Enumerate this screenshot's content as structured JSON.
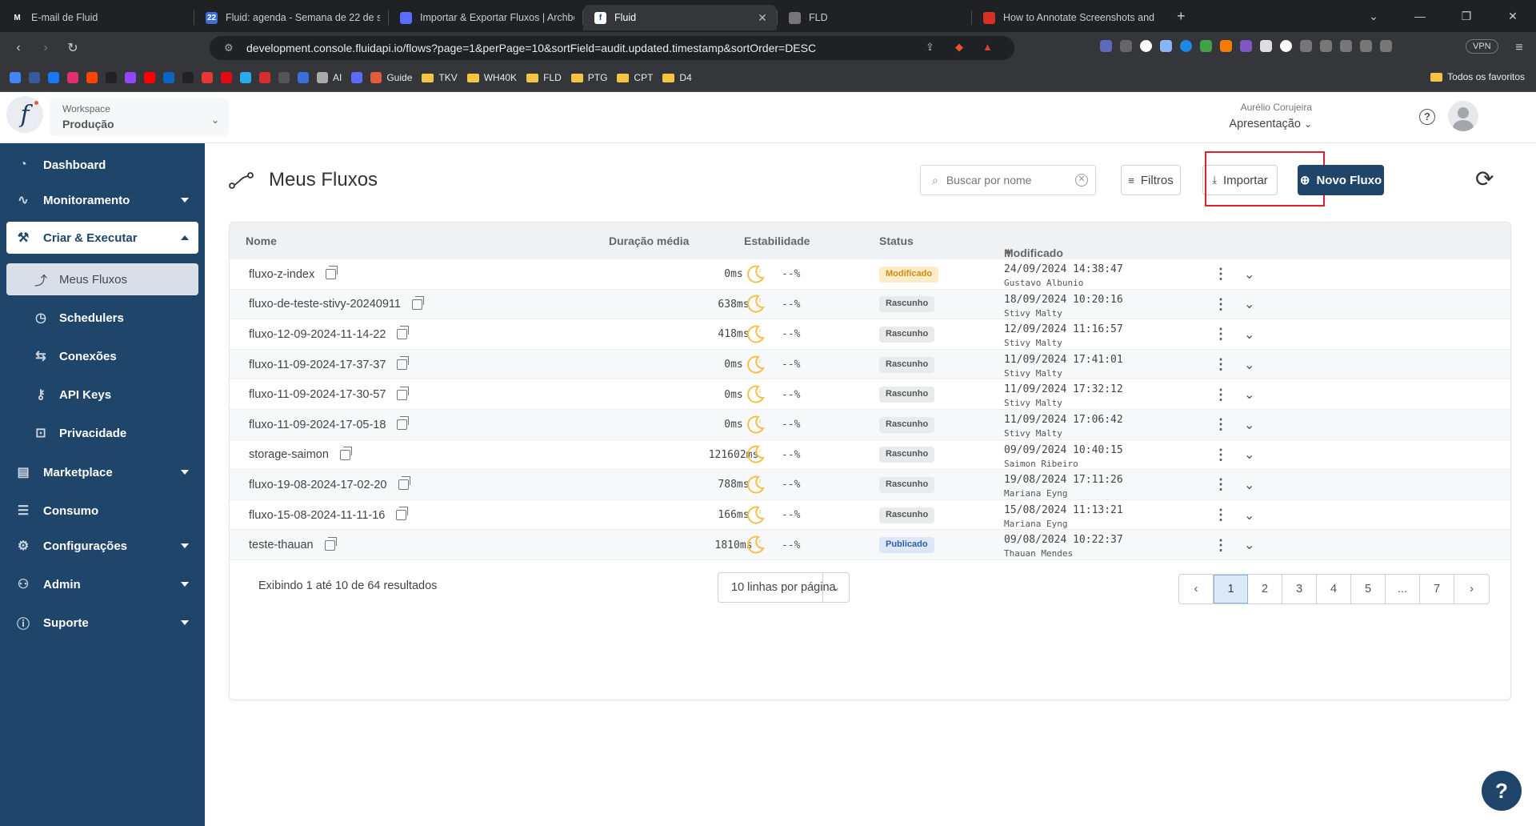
{
  "browser": {
    "tabs": [
      {
        "title": "E-mail de Fluid",
        "fav_color": "#202124",
        "fav_text": "M",
        "active": false
      },
      {
        "title": "Fluid: agenda - Semana de 22 de se",
        "fav_color": "#3b6fd8",
        "fav_text": "22",
        "active": false
      },
      {
        "title": "Importar & Exportar Fluxos | Archbe",
        "fav_color": "#5b6cff",
        "fav_text": "",
        "active": false
      },
      {
        "title": "Fluid",
        "fav_color": "#ffffff",
        "fav_text": "f",
        "active": true
      },
      {
        "title": "FLD",
        "fav_color": "#777",
        "fav_text": "",
        "active": false
      },
      {
        "title": "How to Annotate Screenshots and I",
        "fav_color": "#d93025",
        "fav_text": "",
        "active": false
      }
    ],
    "url": "development.console.fluidapi.io/flows?page=1&perPage=10&sortField=audit.updated.timestamp&sortOrder=DESC",
    "vpn_label": "VPN",
    "bookmarks": [
      {
        "label": "",
        "color": "#4285f4"
      },
      {
        "label": "",
        "color": "#3b5998"
      },
      {
        "label": "",
        "color": "#1877f2"
      },
      {
        "label": "",
        "color": "#e1306c"
      },
      {
        "label": "",
        "color": "#ff4500"
      },
      {
        "label": "",
        "color": "#222"
      },
      {
        "label": "",
        "color": "#9146ff"
      },
      {
        "label": "",
        "color": "#ff0000"
      },
      {
        "label": "",
        "color": "#0a66c2"
      },
      {
        "label": "",
        "color": "#222"
      },
      {
        "label": "",
        "color": "#e53935"
      },
      {
        "label": "",
        "color": "#e50914"
      },
      {
        "label": "",
        "color": "#2aabee"
      },
      {
        "label": "",
        "color": "#d32f2f"
      },
      {
        "label": "",
        "color": "#555"
      },
      {
        "label": "",
        "color": "#3b6fd8"
      },
      {
        "label": "AI",
        "color": "#aaa"
      },
      {
        "label": "",
        "color": "#5b6cff"
      },
      {
        "label": "Guide",
        "color": "#e25c3a"
      }
    ],
    "bookmark_folders": [
      "TKV",
      "WH40K",
      "FLD",
      "PTG",
      "CPT",
      "D4"
    ],
    "all_bookmarks": "Todos os favoritos"
  },
  "header": {
    "workspace_label": "Workspace",
    "workspace_value": "Produção",
    "user_name": "Aurélio Corujeira",
    "user_workspace": "Apresentação"
  },
  "sidebar": {
    "dashboard": "Dashboard",
    "monitoramento": "Monitoramento",
    "criar": "Criar & Executar",
    "meus_fluxos": "Meus Fluxos",
    "schedulers": "Schedulers",
    "conexoes": "Conexões",
    "api_keys": "API Keys",
    "privacidade": "Privacidade",
    "marketplace": "Marketplace",
    "consumo": "Consumo",
    "configuracoes": "Configurações",
    "admin": "Admin",
    "suporte": "Suporte"
  },
  "page": {
    "title": "Meus Fluxos",
    "search_placeholder": "Buscar por nome",
    "filters_label": "Filtros",
    "import_label": "Importar",
    "new_flow_label": "Novo Fluxo"
  },
  "table": {
    "headers": {
      "name": "Nome",
      "duration": "Duração média",
      "stability": "Estabilidade",
      "status": "Status",
      "modified": "Modificado"
    },
    "rows": [
      {
        "name": "fluxo-z-index",
        "duration": "0ms",
        "stability": "--%",
        "status": "Modificado",
        "status_kind": "modified",
        "modified": "24/09/2024 14:38:47",
        "user": "Gustavo Albunio"
      },
      {
        "name": "fluxo-de-teste-stivy-20240911",
        "duration": "638ms",
        "stability": "--%",
        "status": "Rascunho",
        "status_kind": "draft",
        "modified": "18/09/2024 10:20:16",
        "user": "Stivy Malty"
      },
      {
        "name": "fluxo-12-09-2024-11-14-22",
        "duration": "418ms",
        "stability": "--%",
        "status": "Rascunho",
        "status_kind": "draft",
        "modified": "12/09/2024 11:16:57",
        "user": "Stivy Malty"
      },
      {
        "name": "fluxo-11-09-2024-17-37-37",
        "duration": "0ms",
        "stability": "--%",
        "status": "Rascunho",
        "status_kind": "draft",
        "modified": "11/09/2024 17:41:01",
        "user": "Stivy Malty"
      },
      {
        "name": "fluxo-11-09-2024-17-30-57",
        "duration": "0ms",
        "stability": "--%",
        "status": "Rascunho",
        "status_kind": "draft",
        "modified": "11/09/2024 17:32:12",
        "user": "Stivy Malty"
      },
      {
        "name": "fluxo-11-09-2024-17-05-18",
        "duration": "0ms",
        "stability": "--%",
        "status": "Rascunho",
        "status_kind": "draft",
        "modified": "11/09/2024 17:06:42",
        "user": "Stivy Malty"
      },
      {
        "name": "storage-saimon",
        "duration": "121602ms",
        "stability": "--%",
        "status": "Rascunho",
        "status_kind": "draft",
        "modified": "09/09/2024 10:40:15",
        "user": "Saimon Ribeiro"
      },
      {
        "name": "fluxo-19-08-2024-17-02-20",
        "duration": "788ms",
        "stability": "--%",
        "status": "Rascunho",
        "status_kind": "draft",
        "modified": "19/08/2024 17:11:26",
        "user": "Mariana Eyng"
      },
      {
        "name": "fluxo-15-08-2024-11-11-16",
        "duration": "166ms",
        "stability": "--%",
        "status": "Rascunho",
        "status_kind": "draft",
        "modified": "15/08/2024 11:13:21",
        "user": "Mariana Eyng"
      },
      {
        "name": "teste-thauan",
        "duration": "1810ms",
        "stability": "--%",
        "status": "Publicado",
        "status_kind": "published",
        "modified": "09/08/2024 10:22:37",
        "user": "Thauan Mendes"
      }
    ]
  },
  "footer": {
    "showing_prefix": "Exibindo",
    "showing_from": "1",
    "showing_mid": "até",
    "showing_to": "10",
    "showing_of": "de",
    "showing_total": "64",
    "showing_suffix": "resultados",
    "per_page": "10 linhas por página",
    "pages": [
      "1",
      "2",
      "3",
      "4",
      "5",
      "...",
      "7"
    ],
    "current_page": "1"
  },
  "colors": {
    "sidebar_bg": "#1f456b",
    "primary": "#1f456b",
    "highlight_box": "#e0202b",
    "modified_badge_bg": "#fdecc8",
    "modified_badge_fg": "#d48a12",
    "draft_badge_bg": "#e9eaec",
    "draft_badge_fg": "#555555",
    "published_badge_bg": "#dde7f7",
    "published_badge_fg": "#2f5fa8",
    "moon": "#f2c14e"
  },
  "fab_label": "?"
}
